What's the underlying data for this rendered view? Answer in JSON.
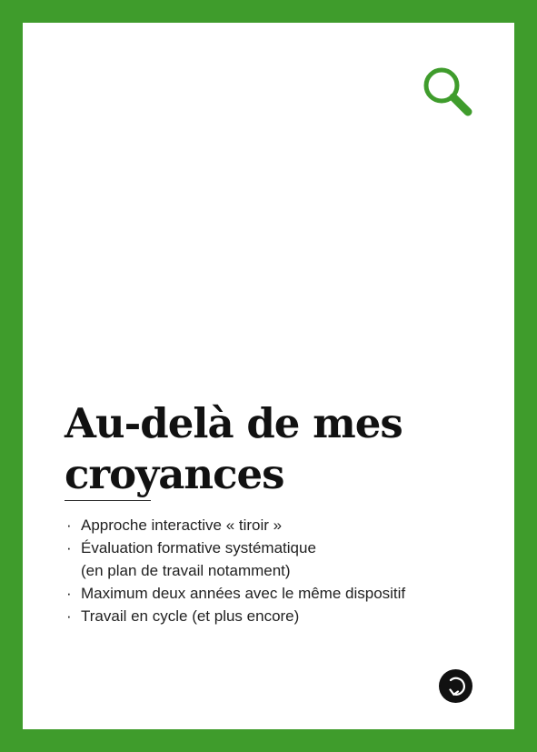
{
  "card": {
    "title_line_1": "Au-delà de mes",
    "title_line_2": "croyances",
    "bullet_symbol": "·",
    "bullets": [
      {
        "lines": [
          "Approche interactive « tiroir »"
        ]
      },
      {
        "lines": [
          "Évaluation formative systématique",
          "(en plan de travail notamment)"
        ]
      },
      {
        "lines": [
          "Maximum deux années avec le même dispositif"
        ]
      },
      {
        "lines": [
          "Travail en cycle (et plus encore)"
        ]
      }
    ]
  },
  "colors": {
    "border": "#3f9c2c",
    "accent": "#3f9c2c",
    "text": "#111111",
    "button": "#111111"
  },
  "icons": {
    "search": "search-icon",
    "flip": "flip-card-icon"
  }
}
